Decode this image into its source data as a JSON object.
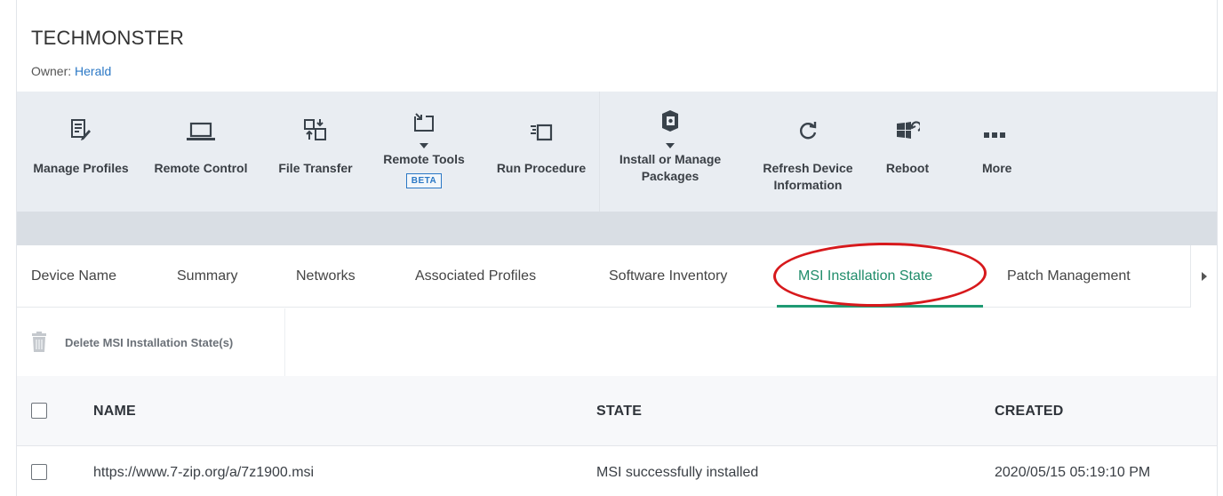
{
  "device": {
    "name": "TECHMONSTER",
    "owner_label": "Owner:",
    "owner_name": "Herald"
  },
  "toolbar": {
    "manage_profiles": "Manage Profiles",
    "remote_control": "Remote Control",
    "file_transfer": "File Transfer",
    "remote_tools": "Remote Tools",
    "remote_tools_badge": "BETA",
    "run_procedure": "Run Procedure",
    "install_packages_line1": "Install or Manage",
    "install_packages_line2": "Packages",
    "refresh_line1": "Refresh Device",
    "refresh_line2": "Information",
    "reboot": "Reboot",
    "more": "More"
  },
  "tabs": {
    "device_name": "Device Name",
    "summary": "Summary",
    "networks": "Networks",
    "associated_profiles": "Associated Profiles",
    "software_inventory": "Software Inventory",
    "msi_installation_state": "MSI Installation State",
    "patch_management": "Patch Management",
    "active": "MSI Installation State"
  },
  "actions": {
    "delete_label": "Delete MSI Installation State(s)"
  },
  "table": {
    "columns": {
      "name": "NAME",
      "state": "STATE",
      "created": "CREATED"
    },
    "rows": [
      {
        "name": "https://www.7-zip.org/a/7z1900.msi",
        "state": "MSI successfully installed",
        "created": "2020/05/15 05:19:10 PM"
      }
    ]
  },
  "colors": {
    "accent_green": "#1f9a73",
    "link_blue": "#2b78c5",
    "highlight_red": "#d7191c",
    "toolbar_bg": "#e9edf2"
  }
}
